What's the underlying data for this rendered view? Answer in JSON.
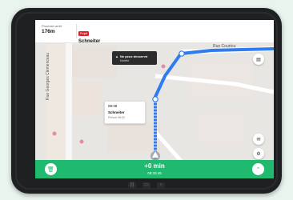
{
  "header": {
    "next_label": "Prochain arrêt",
    "distance": "176m",
    "dest_tag": "Projet",
    "dest_name": "Schneiter"
  },
  "callout": {
    "title": "Ne peux desservir",
    "subtitle": "Matelle"
  },
  "stop_card": {
    "time": "08:35",
    "name": "Schneiter",
    "note": "Prévue 08:32"
  },
  "streets": {
    "left": "Rue Georges Clemenceau",
    "top_right": "Rue Courtou"
  },
  "bottom": {
    "eta": "+0 min",
    "time": "08:33:45"
  },
  "icons": {
    "map_layers": "layers-icon",
    "chat": "chat-icon",
    "settings": "gear-icon",
    "trash": "trash-icon",
    "expand": "chevron-up-icon"
  },
  "colors": {
    "route": "#2f7bef",
    "accent": "#1fba6f",
    "tag": "#d9232e"
  }
}
